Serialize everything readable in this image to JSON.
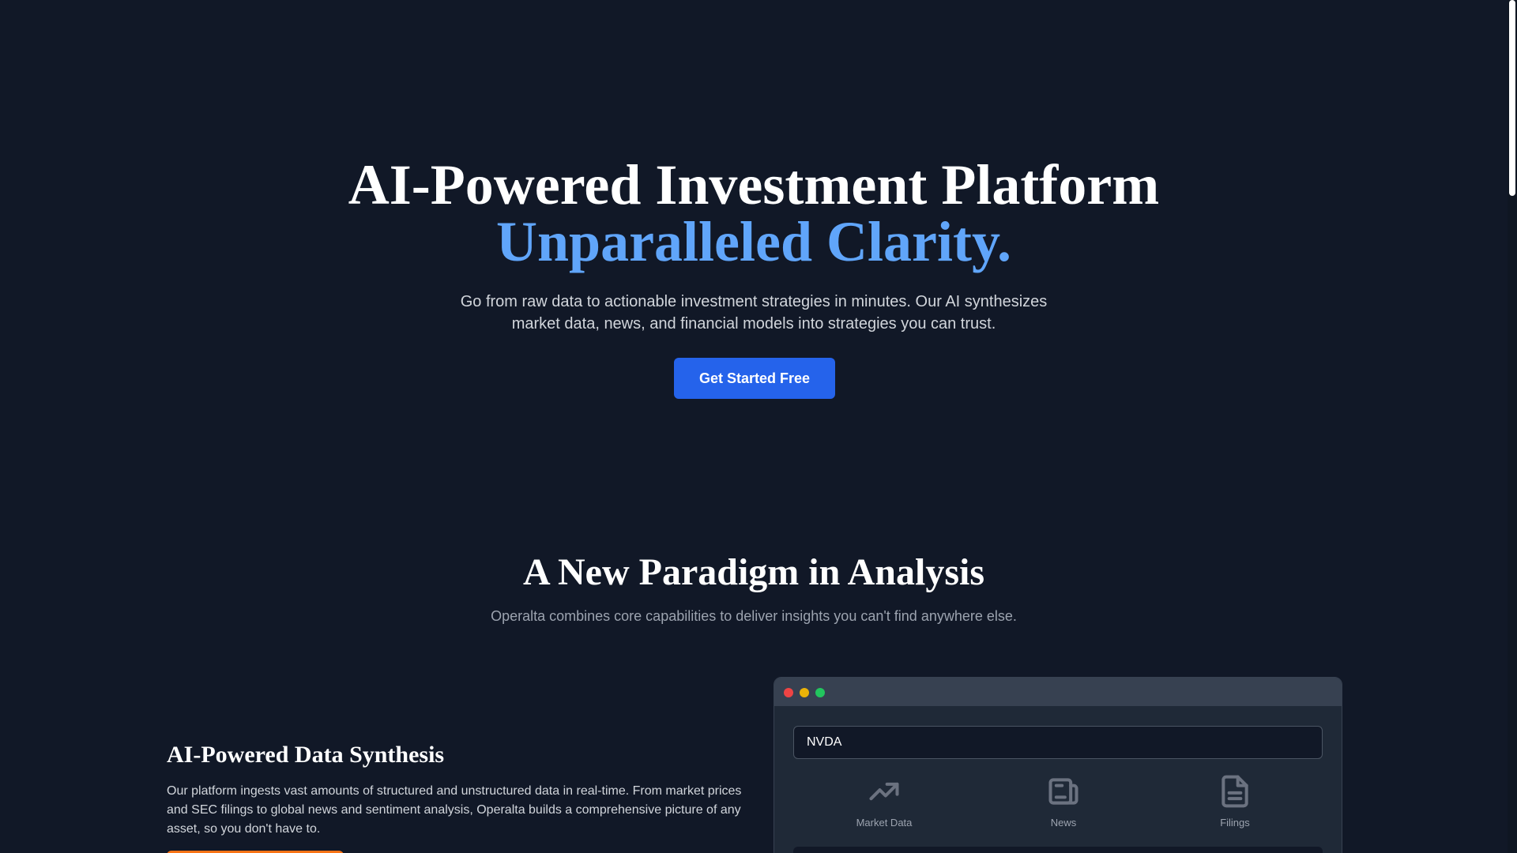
{
  "hero": {
    "title_line1": "AI-Powered Investment Platform",
    "title_line2": "Unparalleled Clarity.",
    "subtitle": "Go from raw data to actionable investment strategies in minutes. Our AI synthesizes market data, news, and financial models into strategies you can trust.",
    "cta_label": "Get Started Free"
  },
  "section": {
    "title": "A New Paradigm in Analysis",
    "subtitle": "Operalta combines core capabilities to deliver insights you can't find anywhere else."
  },
  "feature": {
    "title": "AI-Powered Data Synthesis",
    "body": "Our platform ingests vast amounts of structured and unstructured data in real-time. From market prices and SEC filings to global news and sentiment analysis, Operalta builds a comprehensive picture of any asset, so you don't have to."
  },
  "mock": {
    "ticker_value": "NVDA",
    "sources": [
      {
        "label": "Market Data",
        "icon": "trending-up-icon"
      },
      {
        "label": "News",
        "icon": "newspaper-icon"
      },
      {
        "label": "Filings",
        "icon": "document-icon"
      }
    ]
  },
  "colors": {
    "background": "#111827",
    "accent": "#60a5fa",
    "primary_button": "#2563eb",
    "secondary_button": "#f97316"
  }
}
